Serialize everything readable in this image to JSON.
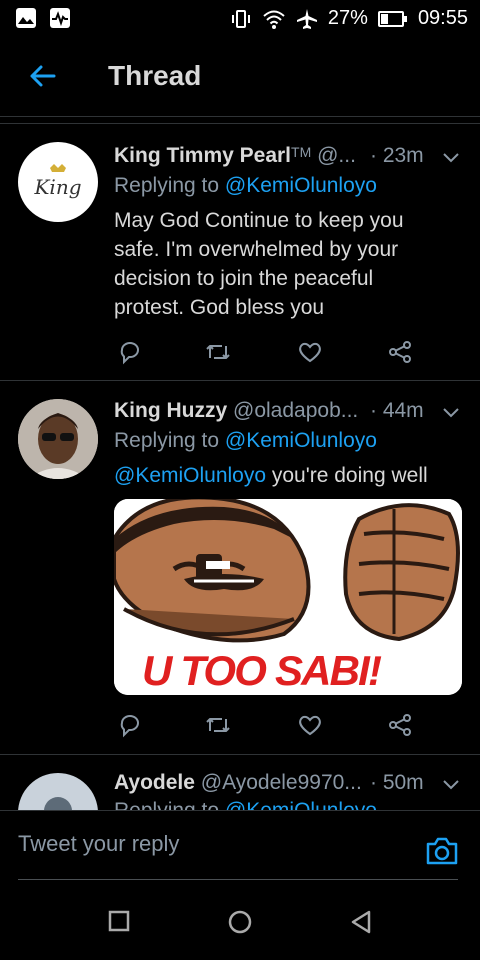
{
  "status_bar": {
    "battery": "27%",
    "time": "09:55"
  },
  "header": {
    "title": "Thread"
  },
  "tweets": [
    {
      "name": "King Timmy Pearl",
      "badge": "TM",
      "handle": "@...",
      "time": "· 23m",
      "replying_prefix": "Replying to ",
      "replying_to": "@KemiOlunloyo",
      "avatar_text": "King",
      "body": "May God Continue to keep you safe. I'm overwhelmed by your decision to join the peaceful protest. God bless you"
    },
    {
      "name": "King Huzzy",
      "handle": "@oladapob...",
      "time": "· 44m",
      "replying_prefix": "Replying to ",
      "replying_to": "@KemiOlunloyo",
      "body_mention": "@KemiOlunloyo",
      "body_rest": " you're doing well",
      "image_caption": "U TOO SABI!"
    },
    {
      "name": "Ayodele",
      "handle": "@Ayodele9970...",
      "time": "· 50m",
      "replying_prefix": "Replying to ",
      "replying_to": "@KemiOlunloyo"
    }
  ],
  "reply_bar": {
    "placeholder": "Tweet your reply"
  },
  "icons": {
    "back": "arrow-left-icon",
    "reply": "reply-icon",
    "retweet": "retweet-icon",
    "like": "heart-icon",
    "share": "share-icon",
    "camera": "camera-icon"
  },
  "colors": {
    "background": "#000000",
    "accent": "#1da1f2",
    "secondary_text": "#8b98a5",
    "divider": "#2f3336"
  }
}
